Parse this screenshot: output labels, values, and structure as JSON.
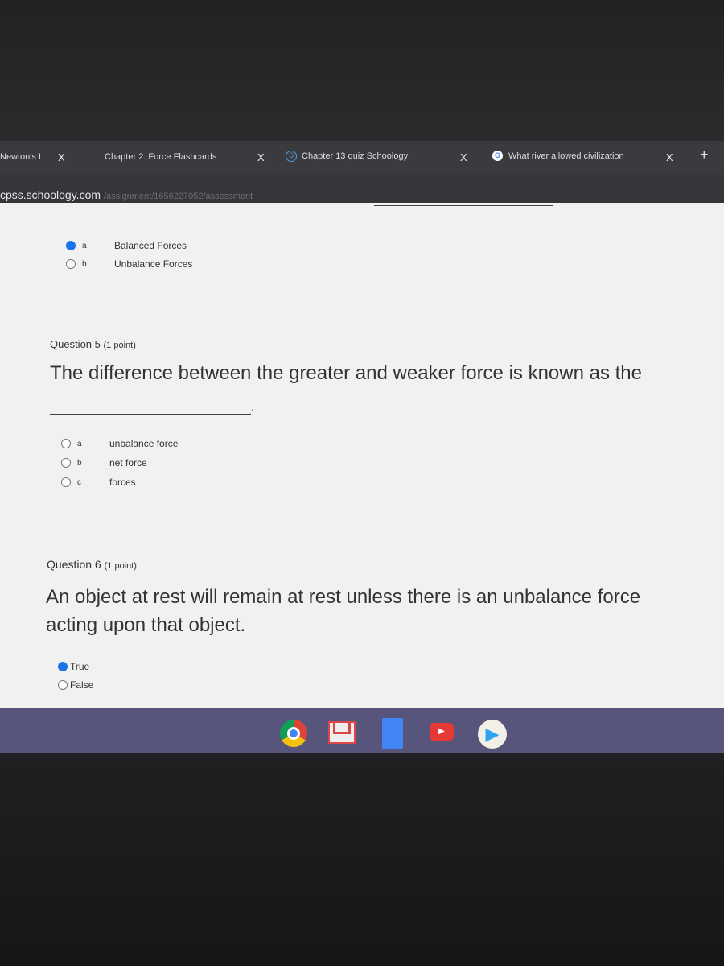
{
  "tabs": [
    {
      "label": "Newton's L",
      "close": "X"
    },
    {
      "label": "Chapter 2: Force Flashcards",
      "close": "X"
    },
    {
      "label": "Chapter 13 quiz  Schoology",
      "close": "X",
      "icon": "schoology-icon"
    },
    {
      "label": "What river allowed civilization",
      "close": "X",
      "icon": "google-icon"
    }
  ],
  "new_tab": "+",
  "url": {
    "domain": "cpss.schoology.com",
    "path": "/assignment/1656227052/assessment"
  },
  "q4": {
    "options": [
      {
        "letter": "a",
        "text": "Balanced Forces",
        "selected": true
      },
      {
        "letter": "b",
        "text": "Unbalance Forces",
        "selected": false
      }
    ]
  },
  "q5": {
    "header": "Question 5",
    "points": "(1 point)",
    "text": "The difference between the greater and weaker force is known as the",
    "blank_end": ".",
    "options": [
      {
        "letter": "a",
        "text": "unbalance force",
        "selected": false
      },
      {
        "letter": "b",
        "text": "net force",
        "selected": false
      },
      {
        "letter": "c",
        "text": "forces",
        "selected": false
      }
    ]
  },
  "q6": {
    "header": "Question 6",
    "points": "(1 point)",
    "line1": "An object at rest will remain at rest unless there is an unbalance force",
    "line2": "acting upon that object.",
    "options": [
      {
        "text": "True",
        "selected": true
      },
      {
        "text": "False",
        "selected": false
      }
    ]
  },
  "shelf": [
    "chrome-icon",
    "gmail-icon",
    "docs-icon",
    "youtube-icon",
    "play-store-icon"
  ]
}
